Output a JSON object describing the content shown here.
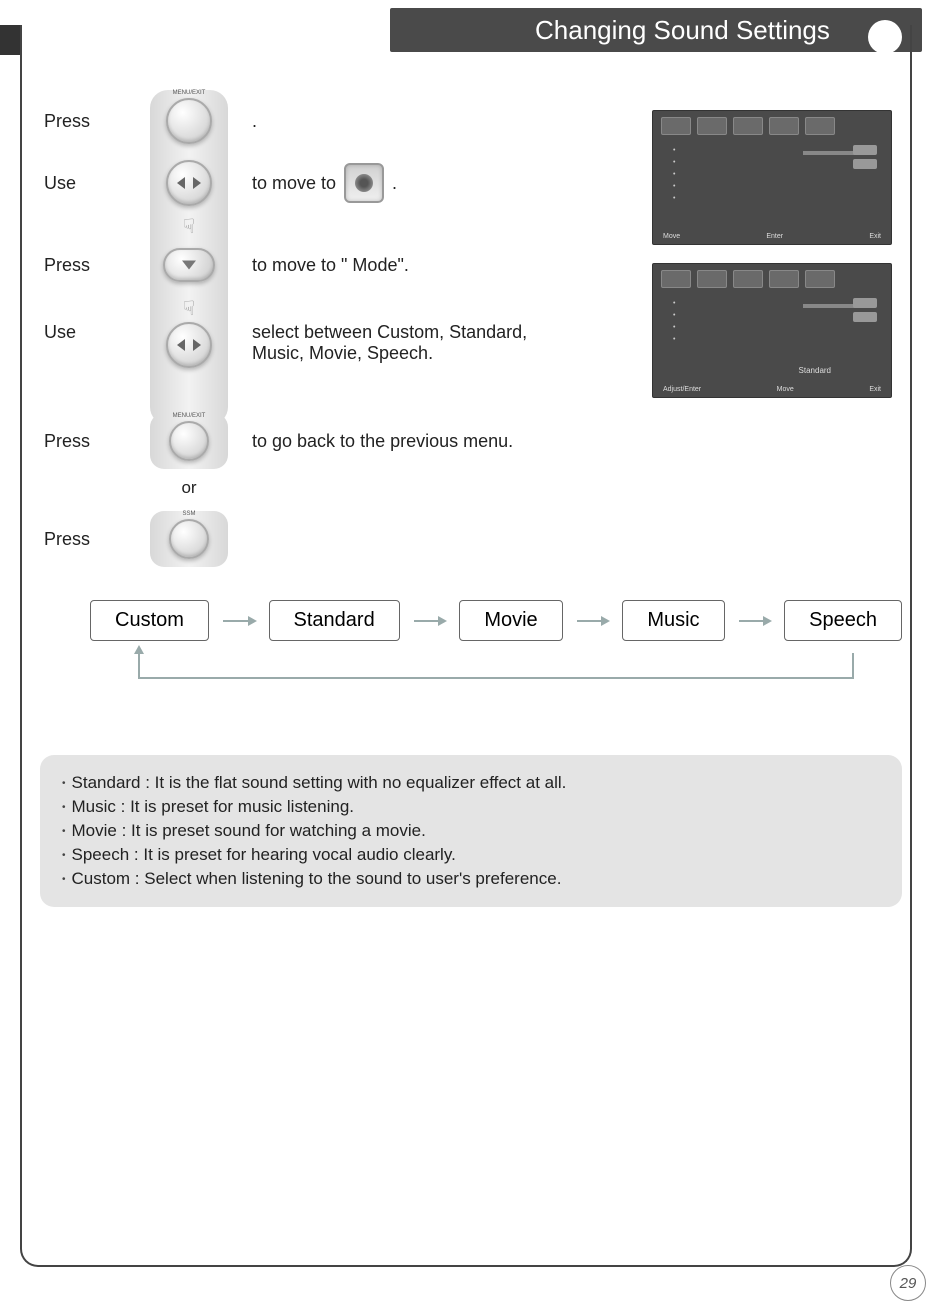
{
  "title": "Changing Sound Settings",
  "page_number": "29",
  "steps": {
    "s1": {
      "verb": "Press",
      "text": ".",
      "button": "MENU/EXIT"
    },
    "s2": {
      "verb": "Use",
      "text_pre": "to move to",
      "text_post": "."
    },
    "s3": {
      "verb": "Press",
      "text": "to move to \" Mode\"."
    },
    "s4": {
      "verb": "Use",
      "text_line1": "select between Custom, Standard,",
      "text_line2": " Music, Movie, Speech."
    },
    "s5": {
      "verb": "Press",
      "text": "to go back to the previous menu.",
      "button": "MENU/EXIT"
    },
    "or": "or",
    "s6": {
      "verb": "Press",
      "button": "SSM"
    }
  },
  "modes": [
    "Custom",
    "Standard",
    "Movie",
    "Music",
    "Speech"
  ],
  "descriptions": {
    "d1": "Standard : It is the flat sound setting with no equalizer effect at all.",
    "d2": "Music : It is preset for music listening.",
    "d3": "Movie : It is preset sound for watching a movie.",
    "d4": "Speech : It is preset for hearing vocal audio clearly.",
    "d5": "Custom : Select when listening to the sound to user's preference."
  },
  "tv": {
    "footer_move": "Move",
    "footer_enter": "Enter",
    "footer_exit": "Exit",
    "footer_adjust": "Adjust/Enter",
    "mode_value": "Standard"
  }
}
